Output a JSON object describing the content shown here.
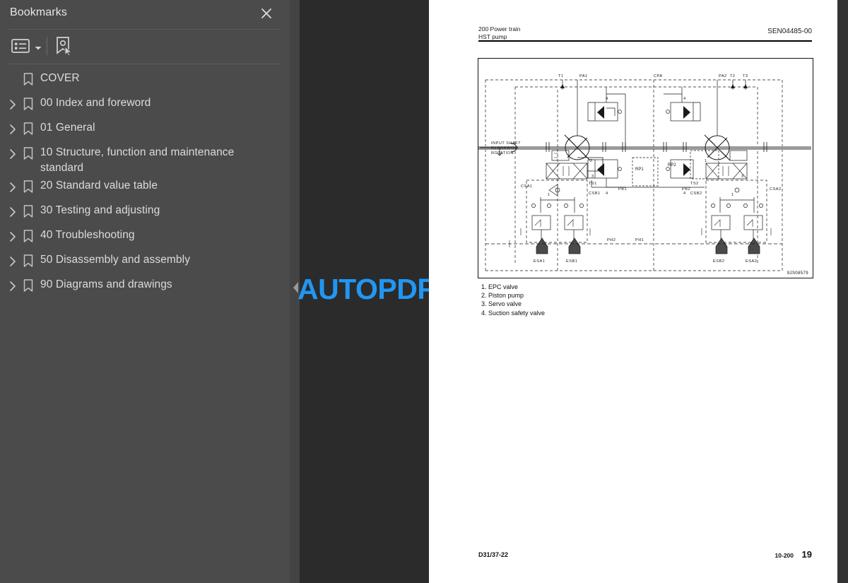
{
  "sidebar": {
    "title": "Bookmarks",
    "close_icon": "close-icon",
    "toolbar": {
      "list_options_icon": "list-options-icon",
      "caret_icon": "chevron-down-icon",
      "new_bookmark_icon": "new-bookmark-icon"
    },
    "items": [
      {
        "label": "COVER",
        "expandable": false
      },
      {
        "label": "00 Index and foreword",
        "expandable": true
      },
      {
        "label": "01 General",
        "expandable": true
      },
      {
        "label": "10 Structure, function and maintenance standard",
        "expandable": true
      },
      {
        "label": "20 Standard value table",
        "expandable": true
      },
      {
        "label": "30 Testing and adjusting",
        "expandable": true
      },
      {
        "label": "40 Troubleshooting",
        "expandable": true
      },
      {
        "label": "50 Disassembly and assembly",
        "expandable": true
      },
      {
        "label": "90 Diagrams and drawings",
        "expandable": true
      }
    ]
  },
  "viewer": {
    "watermark": "AUTOPDF.NET",
    "collapse_icon": "collapse-left-icon"
  },
  "document": {
    "header": {
      "section": "200 Power train",
      "subsection": "HST pump",
      "doc_number": "SEN04485-00"
    },
    "figure": {
      "drawing_number": "9JS08579",
      "note": "INPUT SHAFT CLOCKWISE ROTATION",
      "note_lines": [
        "INPUT SHAFT",
        "CLOCKWISE",
        "ROTATION"
      ],
      "port_labels": [
        "T1",
        "PA1",
        "CPA",
        "PA2",
        "T2",
        "T3",
        "RP1",
        "RP2",
        "PB1",
        "PH1",
        "PH2",
        "PB2",
        "CSA1",
        "CSB1",
        "TS1",
        "TS2",
        "CSB2",
        "CSA2",
        "ESA1",
        "ESB1",
        "ESB2",
        "ESA2"
      ],
      "callouts": [
        "1",
        "2",
        "3",
        "4"
      ]
    },
    "legend": [
      "1. EPC valve",
      "2. Piston pump",
      "3. Servo valve",
      "4. Suction safety valve"
    ],
    "footer": {
      "model": "D31/37-22",
      "section_number": "10-200",
      "page_number": "19"
    }
  },
  "colors": {
    "sidebar_bg": "#4b4b4b",
    "viewer_bg": "#2b2b2b",
    "splitter": "#444444",
    "watermark": "#2196f3",
    "text": "#dcdcdc"
  }
}
